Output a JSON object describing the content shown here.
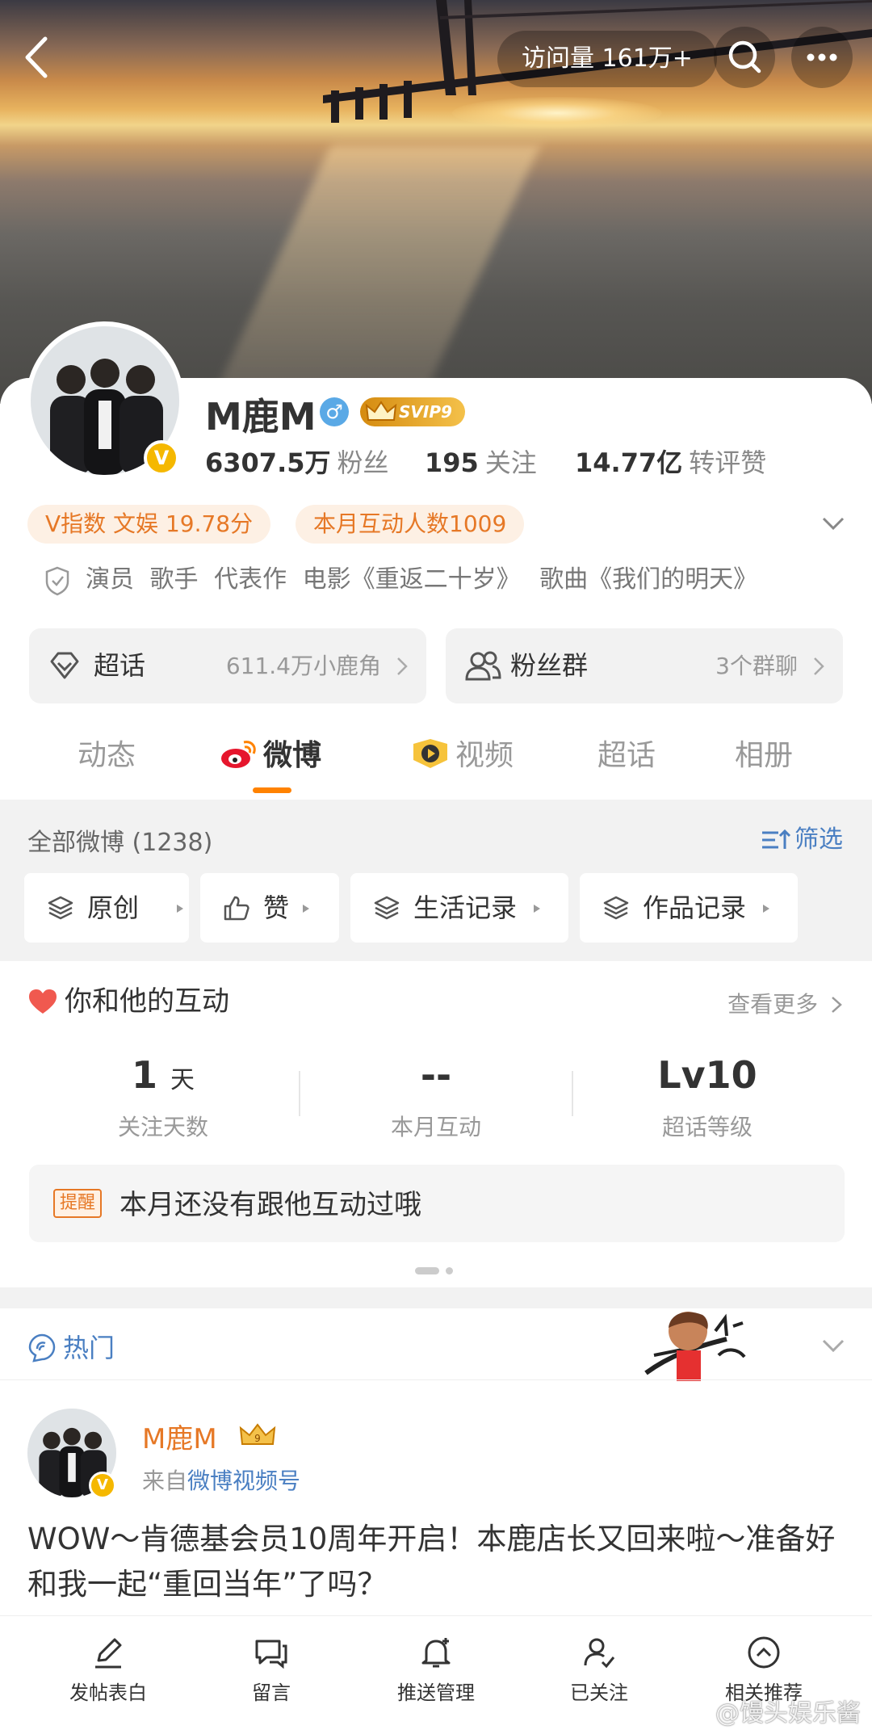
{
  "header": {
    "visits_label": "访问量 161万+"
  },
  "profile": {
    "name": "M鹿M",
    "svip": "SVIP9",
    "verified_badge": "V",
    "stats": [
      {
        "value": "6307.5万",
        "label": "粉丝"
      },
      {
        "value": "195",
        "label": "关注"
      },
      {
        "value": "14.77亿",
        "label": "转评赞"
      }
    ],
    "pills": [
      "V指数 文娱 19.78分",
      "本月互动人数1009"
    ],
    "bio": [
      "演员",
      "歌手",
      "代表作",
      "电影《重返二十岁》",
      "歌曲《我们的明天》"
    ]
  },
  "cards": {
    "supertopic": {
      "label": "超话",
      "value": "611.4万小鹿角"
    },
    "fangroup": {
      "label": "粉丝群",
      "value": "3个群聊"
    }
  },
  "tabs": [
    "动态",
    "微博",
    "视频",
    "超话",
    "相册"
  ],
  "feed_filter": {
    "all_label": "全部微博 (1238)",
    "filter_label": "筛选",
    "chips": [
      "原创",
      "赞",
      "生活记录",
      "作品记录"
    ]
  },
  "interaction": {
    "title": "你和他的互动",
    "more": "查看更多",
    "metrics": [
      {
        "value": "1",
        "unit": "天",
        "label": "关注天数"
      },
      {
        "value": "--",
        "unit": "",
        "label": "本月互动"
      },
      {
        "value": "Lv10",
        "unit": "",
        "label": "超话等级"
      }
    ],
    "remind_tag": "提醒",
    "remind_text": "本月还没有跟他互动过哦"
  },
  "hot": {
    "label": "热门"
  },
  "post": {
    "author": "M鹿M",
    "from_prefix": "来自",
    "from_source": "微博视频号",
    "verified_badge": "V",
    "text": "WOW～肯德基会员10周年开启！本鹿店长又回来啦～准备好和我一起“重回当年”了吗？"
  },
  "bottom_nav": [
    "发帖表白",
    "留言",
    "推送管理",
    "已关注",
    "相关推荐"
  ],
  "watermark": "@馒头娱乐酱",
  "colors": {
    "accent": "#ff8200",
    "link": "#4a7fc2",
    "orange_text": "#e67826"
  }
}
